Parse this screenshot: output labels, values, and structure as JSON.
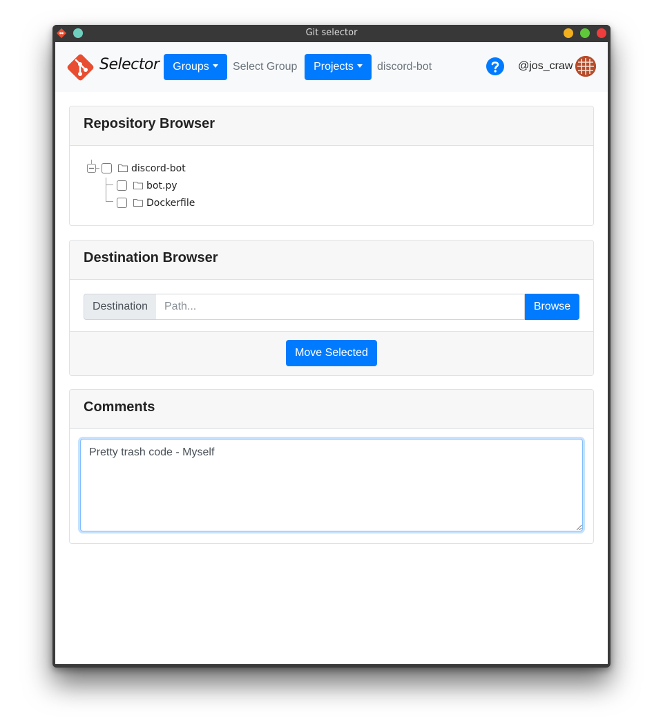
{
  "window": {
    "title": "Git selector"
  },
  "navbar": {
    "brand": "Selector",
    "groups_button": "Groups",
    "selected_group": "Select Group",
    "projects_button": "Projects",
    "selected_project": "discord-bot",
    "username": "@jos_craw"
  },
  "repository_browser": {
    "title": "Repository Browser",
    "tree": {
      "root": {
        "label": "discord-bot",
        "checked": false,
        "expanded": true
      },
      "children": [
        {
          "label": "bot.py",
          "checked": false
        },
        {
          "label": "Dockerfile",
          "checked": false
        }
      ]
    }
  },
  "destination_browser": {
    "title": "Destination Browser",
    "destination_label": "Destination",
    "path_value": "",
    "path_placeholder": "Path...",
    "browse_button": "Browse",
    "move_button": "Move Selected"
  },
  "comments": {
    "title": "Comments",
    "text": "Pretty trash code - Myself"
  },
  "colors": {
    "primary": "#007bff",
    "git_logo": "#e84e31",
    "avatar": "#b84c2b",
    "titlebar": "#383838",
    "close": "#ee3d3d",
    "minimize": "#f2b01e",
    "maximize": "#5ec73a"
  },
  "icons": {
    "app": "git-logo-icon",
    "help": "question-circle-icon",
    "folder": "folder-icon",
    "collapse": "minus-square-icon"
  }
}
